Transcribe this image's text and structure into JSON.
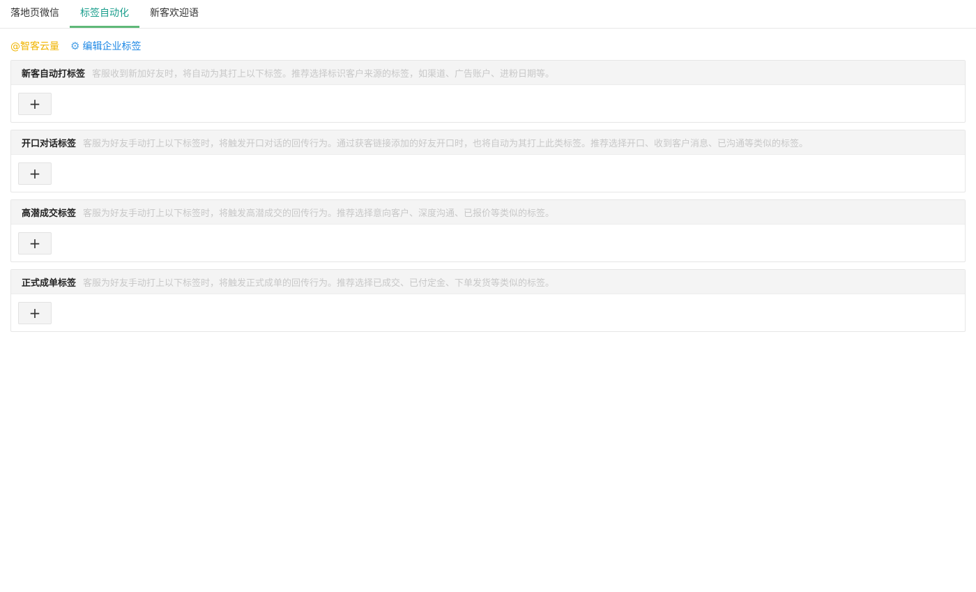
{
  "tabs": [
    {
      "label": "落地页微信",
      "active": false
    },
    {
      "label": "标签自动化",
      "active": true
    },
    {
      "label": "新客欢迎语",
      "active": false
    }
  ],
  "toolbar": {
    "corp_name": "@智客云量",
    "edit_label": "编辑企业标签",
    "gear_icon": "⚙"
  },
  "sections": [
    {
      "title": "新客自动打标签",
      "desc": "客服收到新加好友时，将自动为其打上以下标签。推荐选择标识客户来源的标签，如渠道、广告账户、进粉日期等。",
      "add_label": "+"
    },
    {
      "title": "开口对话标签",
      "desc": "客服为好友手动打上以下标签时，将触发开口对话的回传行为。通过获客链接添加的好友开口时，也将自动为其打上此类标签。推荐选择开口、收到客户消息、已沟通等类似的标签。",
      "add_label": "+"
    },
    {
      "title": "高潜成交标签",
      "desc": "客服为好友手动打上以下标签时，将触发高潜成交的回传行为。推荐选择意向客户、深度沟通、已报价等类似的标签。",
      "add_label": "+"
    },
    {
      "title": "正式成单标签",
      "desc": "客服为好友手动打上以下标签时，将触发正式成单的回传行为。推荐选择已成交、已付定金、下单发货等类似的标签。",
      "add_label": "+"
    }
  ],
  "colors": {
    "accent": "#1a9e8c",
    "tab_underline": "#5fb878",
    "corp_name": "#f0b400",
    "link": "#1e88e5"
  }
}
